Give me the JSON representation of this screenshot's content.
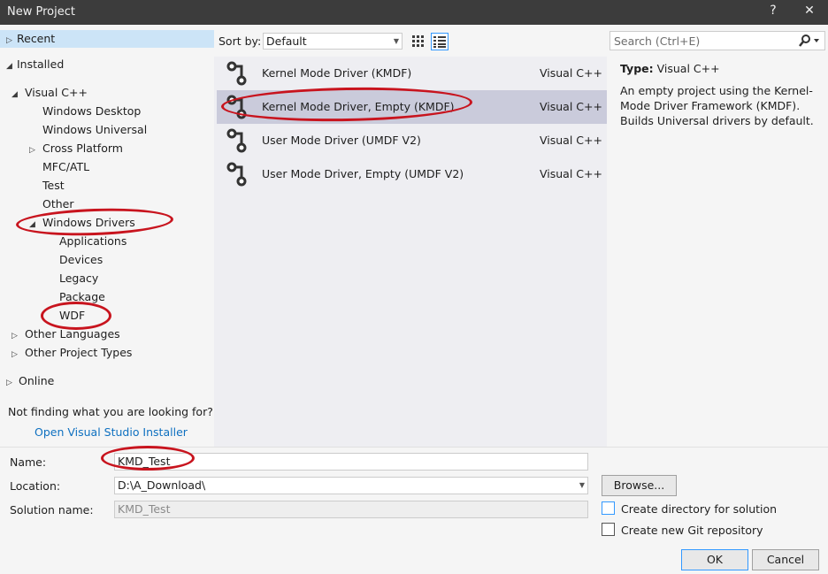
{
  "window": {
    "title": "New Project",
    "help_glyph": "?",
    "close_glyph": "✕"
  },
  "tree": {
    "recent": "Recent",
    "installed": "Installed",
    "visual_cpp": "Visual C++",
    "windows_desktop": "Windows Desktop",
    "windows_universal": "Windows Universal",
    "cross_platform": "Cross Platform",
    "mfc_atl": "MFC/ATL",
    "test": "Test",
    "other": "Other",
    "windows_drivers": "Windows Drivers",
    "applications": "Applications",
    "devices": "Devices",
    "legacy": "Legacy",
    "package": "Package",
    "wdf": "WDF",
    "other_languages": "Other Languages",
    "other_project_types": "Other Project Types",
    "online": "Online"
  },
  "not_finding": "Not finding what you are looking for?",
  "installer_link": "Open Visual Studio Installer",
  "sort": {
    "label": "Sort by:",
    "value": "Default"
  },
  "templates": [
    {
      "name": "Kernel Mode Driver (KMDF)",
      "lang": "Visual C++"
    },
    {
      "name": "Kernel Mode Driver, Empty (KMDF)",
      "lang": "Visual C++"
    },
    {
      "name": "User Mode Driver (UMDF V2)",
      "lang": "Visual C++"
    },
    {
      "name": "User Mode Driver, Empty (UMDF V2)",
      "lang": "Visual C++"
    }
  ],
  "search": {
    "placeholder": "Search (Ctrl+E)"
  },
  "details": {
    "type_label": "Type:",
    "type_value": "Visual C++",
    "description": "An empty project using the Kernel-Mode Driver Framework (KMDF). Builds Universal drivers by default."
  },
  "form": {
    "name_label": "Name:",
    "name_value": "KMD_Test",
    "location_label": "Location:",
    "location_value": "D:\\A_Download\\",
    "solution_label": "Solution name:",
    "solution_value": "KMD_Test",
    "browse": "Browse...",
    "create_dir": "Create directory for solution",
    "create_git": "Create new Git repository",
    "create_dir_checked": false,
    "create_git_checked": false,
    "ok": "OK",
    "cancel": "Cancel"
  },
  "colors": {
    "selection": "#cce4f7",
    "link": "#0e70c0",
    "annotation": "#c8141e",
    "accent": "#3399ff"
  }
}
